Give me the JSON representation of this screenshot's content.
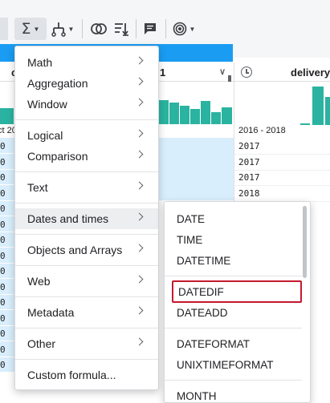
{
  "toolbar": {
    "icons": [
      "sigma-icon",
      "branch-icon",
      "venn-icon",
      "sort-icon",
      "comment-icon",
      "target-icon"
    ],
    "sigma_symbol": "Σ"
  },
  "grid": {
    "left_header_partial": "c",
    "mid_header_partial": "1",
    "right_header": "delivery_",
    "left_range_partial": "ct 20",
    "right_range": "2016 - 2018",
    "left_cell_marks": [
      "0",
      "0",
      "0",
      "0",
      "0",
      "0",
      "0",
      "0",
      "0",
      "0",
      "0",
      "0",
      "0",
      "0",
      "0"
    ],
    "right_years": [
      "2017",
      "2017",
      "2017",
      "2018"
    ]
  },
  "menu": {
    "items": [
      {
        "label": "Math",
        "submenu": true
      },
      {
        "label": "Aggregation",
        "submenu": true
      },
      {
        "label": "Window",
        "submenu": true
      },
      {
        "label": "Logical",
        "submenu": true
      },
      {
        "label": "Comparison",
        "submenu": true
      },
      {
        "label": "Text",
        "submenu": true
      },
      {
        "label": "Dates and times",
        "submenu": true,
        "hover": true
      },
      {
        "label": "Objects and Arrays",
        "submenu": true
      },
      {
        "label": "Web",
        "submenu": true
      },
      {
        "label": "Metadata",
        "submenu": true
      },
      {
        "label": "Other",
        "submenu": true
      },
      {
        "label": "Custom formula...",
        "submenu": false
      }
    ]
  },
  "submenu": {
    "items": [
      "DATE",
      "TIME",
      "DATETIME",
      "DATEDIF",
      "DATEADD",
      "DATEFORMAT",
      "UNIXTIMEFORMAT",
      "MONTH"
    ],
    "selected": "DATEDIF"
  },
  "colors": {
    "accent_blue": "#1a9cf2",
    "histogram_teal": "#2ab3a0",
    "selection_red": "#c5192d",
    "cell_highlight": "#d9eefc"
  }
}
